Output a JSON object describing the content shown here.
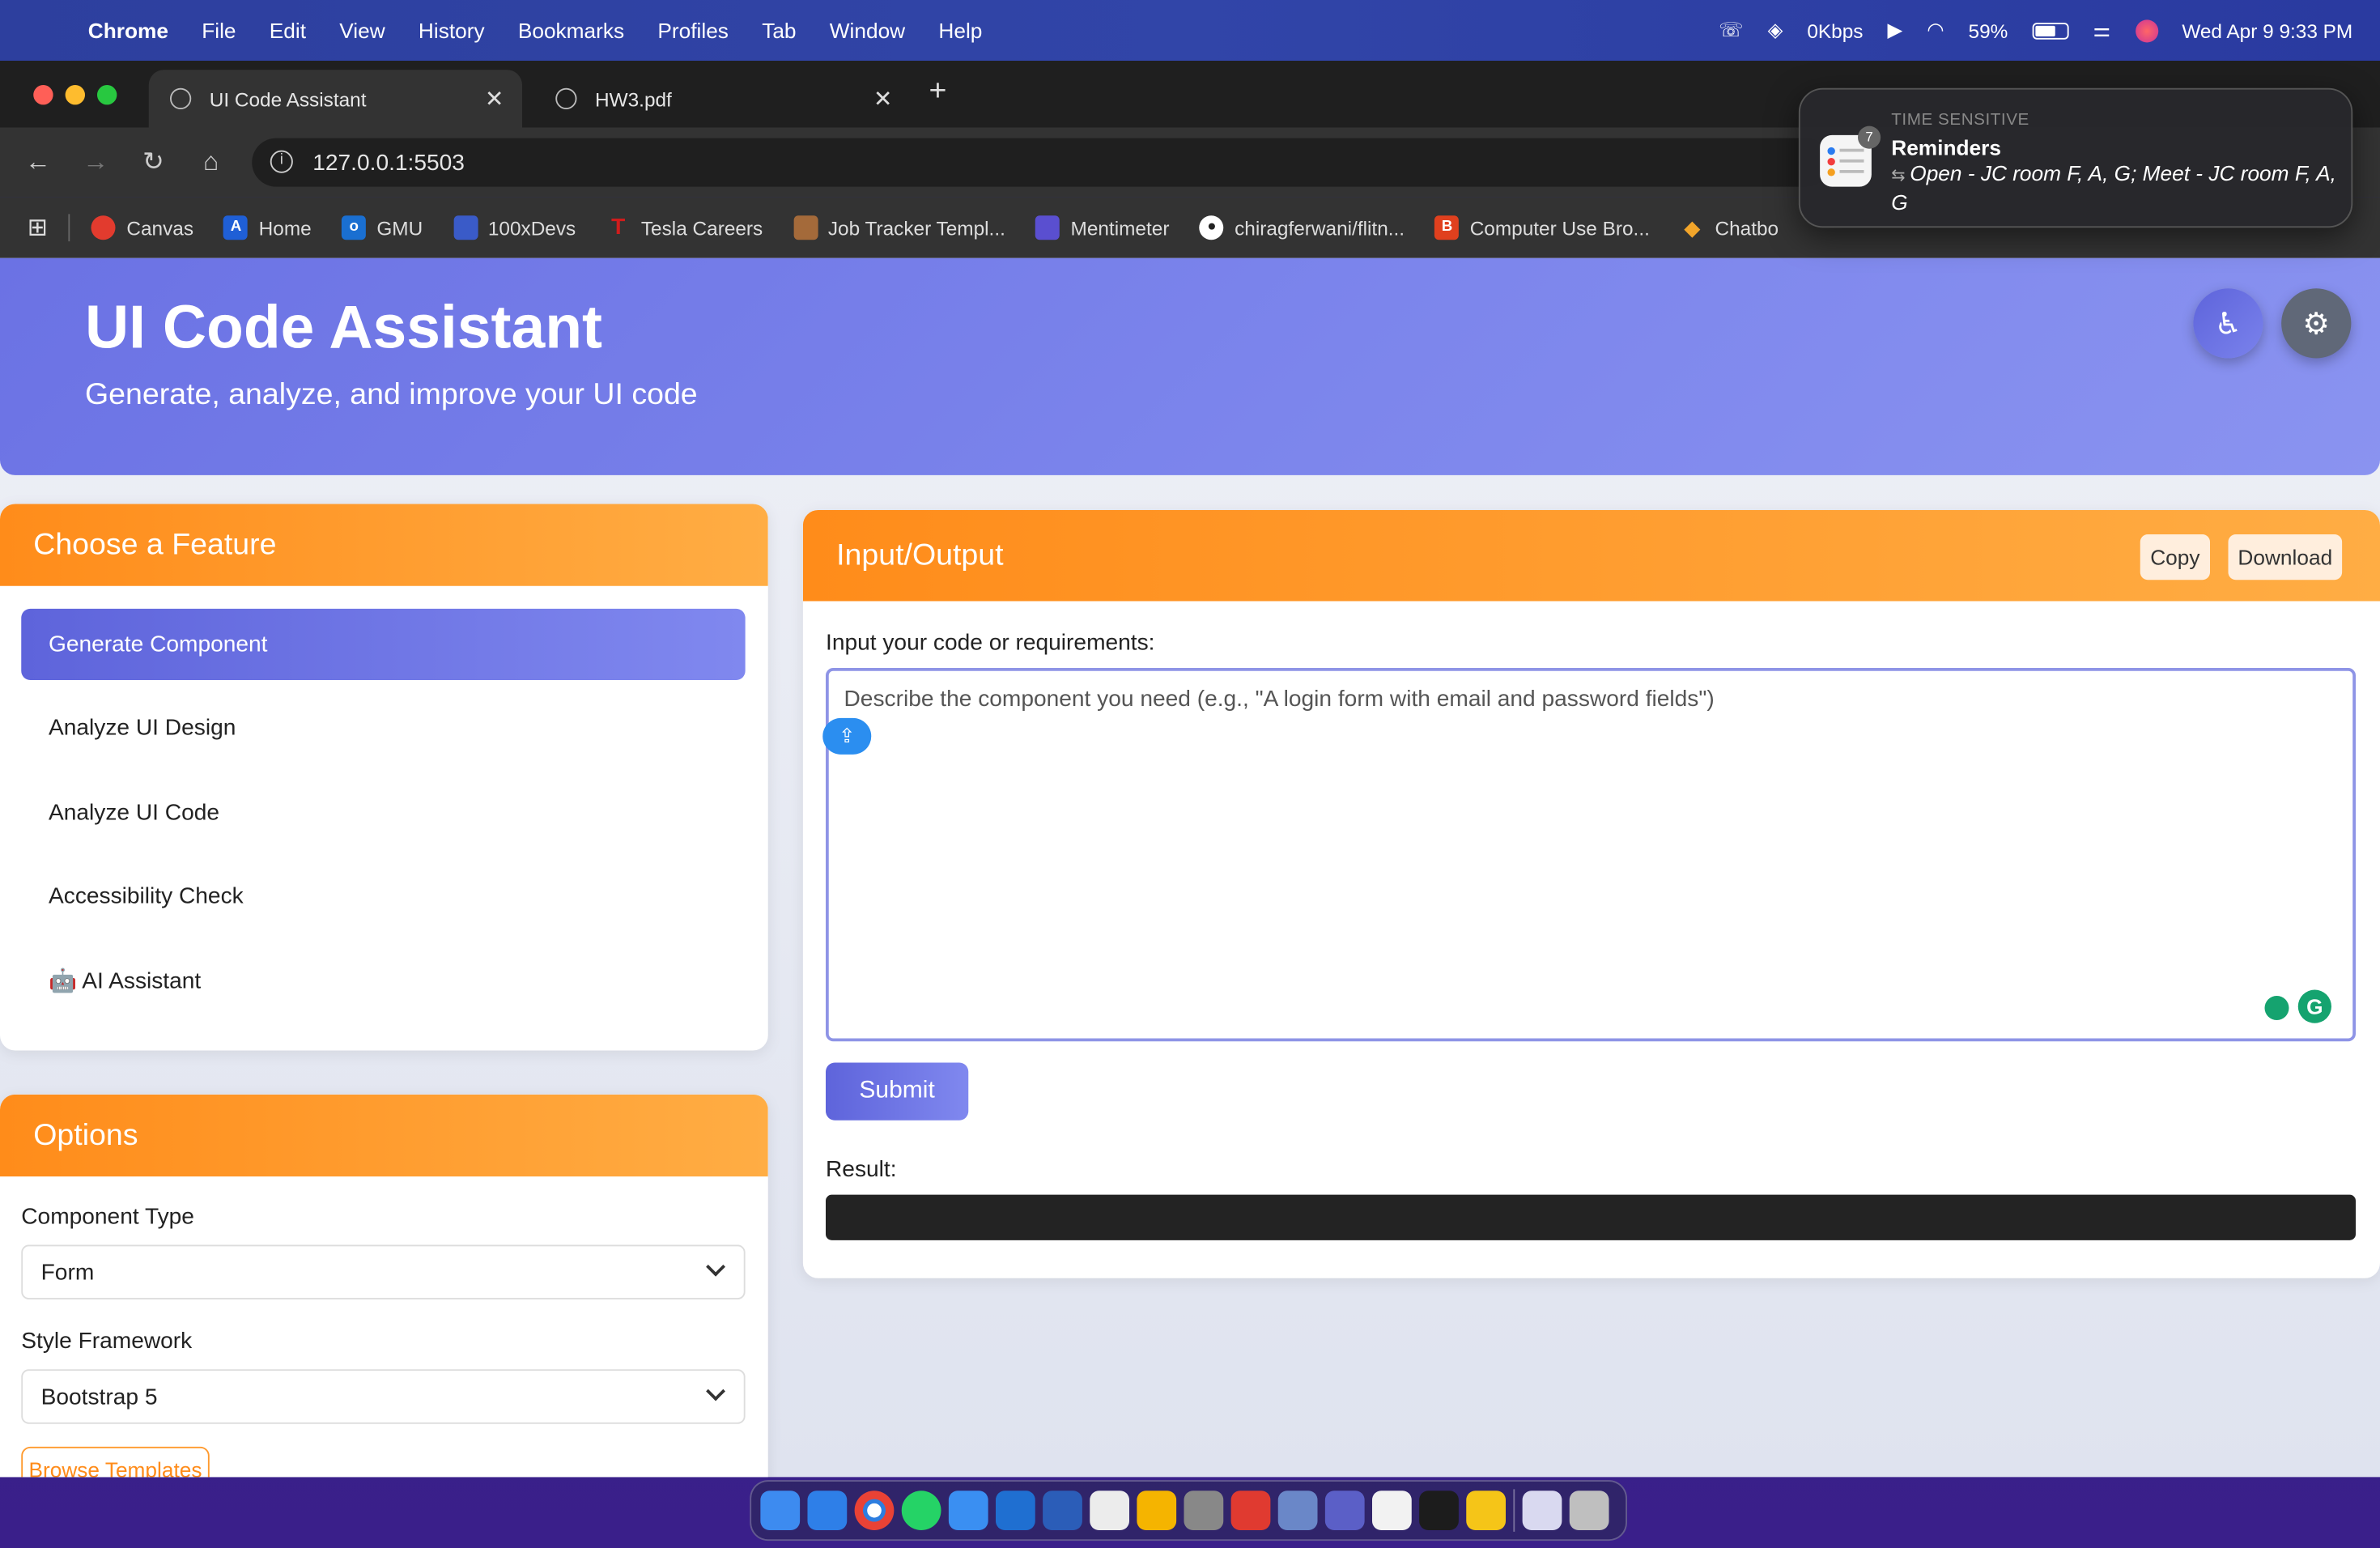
{
  "menubar": {
    "app": "Chrome",
    "items": [
      "File",
      "Edit",
      "View",
      "History",
      "Bookmarks",
      "Profiles",
      "Tab",
      "Window",
      "Help"
    ],
    "network": "0Kbps",
    "battery": "59%",
    "datetime": "Wed Apr 9  9:33 PM"
  },
  "browser": {
    "tabs": [
      {
        "title": "UI Code Assistant"
      },
      {
        "title": "HW3.pdf"
      }
    ],
    "url": "127.0.0.1:5503",
    "bookmarks": [
      {
        "label": "Canvas",
        "color": "#e23b2e"
      },
      {
        "label": "Home",
        "color": "#1f5fd6"
      },
      {
        "label": "GMU",
        "color": "#1a6fd1"
      },
      {
        "label": "100xDevs",
        "color": "#3a5bc8"
      },
      {
        "label": "Tesla Careers",
        "color": "#d01c1c"
      },
      {
        "label": "Job Tracker Templ...",
        "color": "#a46a3a"
      },
      {
        "label": "Mentimeter",
        "color": "#5a4fd0"
      },
      {
        "label": "chiragferwani/flitn...",
        "color": "#222222"
      },
      {
        "label": "Computer Use Bro...",
        "color": "#e0401e"
      },
      {
        "label": "Chatbo",
        "color": "#f2a52a"
      }
    ]
  },
  "notification": {
    "category": "TIME SENSITIVE",
    "title": "Reminders",
    "body": "Open - JC room F, A, G; Meet - JC room F, A, G",
    "badge": "7"
  },
  "header": {
    "title": "UI Code Assistant",
    "subtitle": "Generate, analyze, and improve your UI code"
  },
  "features": {
    "heading": "Choose a Feature",
    "items": [
      {
        "label": "Generate Component",
        "selected": true
      },
      {
        "label": "Analyze UI Design"
      },
      {
        "label": "Analyze UI Code"
      },
      {
        "label": "Accessibility Check"
      },
      {
        "label": "🤖 AI Assistant"
      }
    ]
  },
  "options": {
    "heading": "Options",
    "component_type_label": "Component Type",
    "component_type_value": "Form",
    "style_framework_label": "Style Framework",
    "style_framework_value": "Bootstrap 5",
    "browse_label": "Browse Templates"
  },
  "io": {
    "heading": "Input/Output",
    "copy_label": "Copy",
    "download_label": "Download",
    "input_label": "Input your code or requirements:",
    "placeholder": "Describe the component you need (e.g., \"A login form with email and password fields\")",
    "submit_label": "Submit",
    "result_label": "Result:"
  },
  "colors": {
    "accent_orange": "#ff8c1a",
    "accent_purple": "#6b72e4"
  }
}
